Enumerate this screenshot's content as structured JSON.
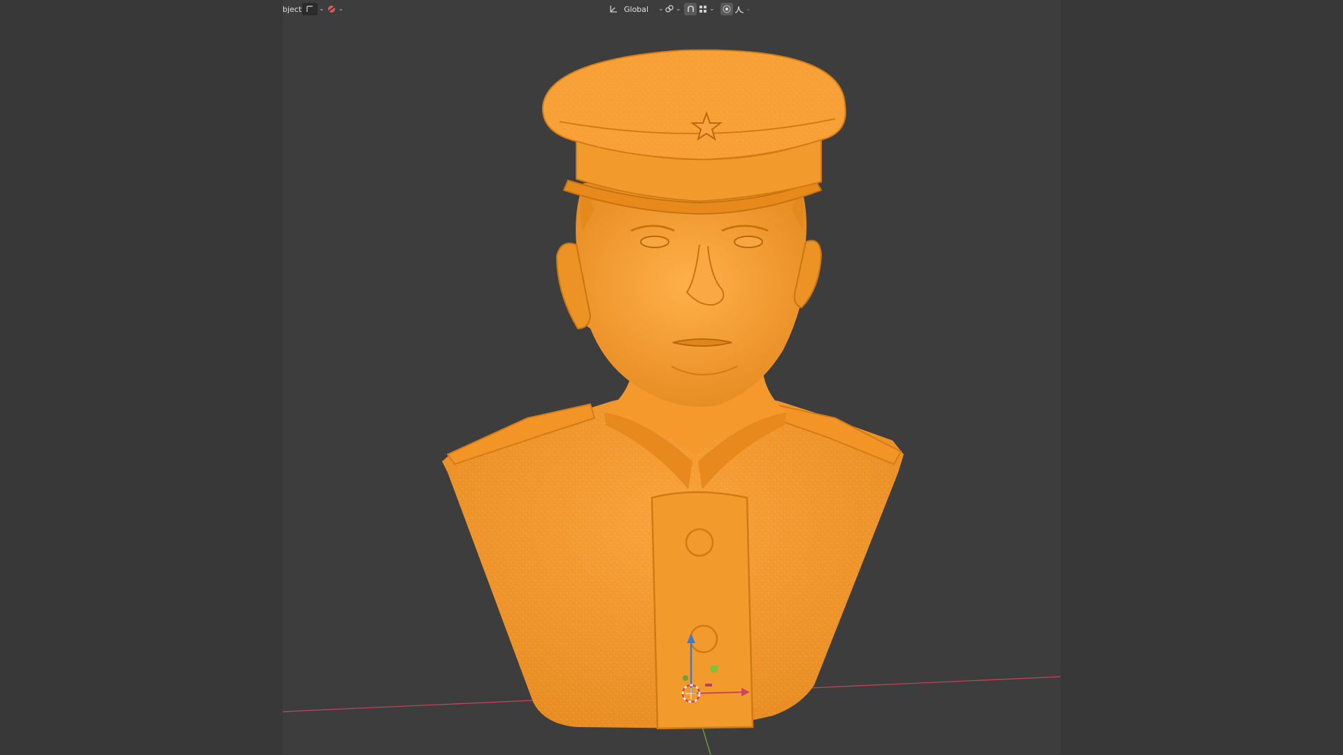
{
  "viewport": {
    "header": {
      "mode_label_partial": "bject",
      "transform_orientation": "Global",
      "icons": [
        "object-mode-icon",
        "transform-orientation-icon",
        "pivot-icon",
        "snap-icon",
        "snap-target-icon",
        "proportional-editing-icon",
        "falloff-icon"
      ]
    },
    "scene": {
      "selected_object": "bust-sculpt",
      "selection_color": "#f59a2a",
      "axes": {
        "x_color": "#c9455b",
        "y_color": "#6aa23a",
        "z_color": "#3b7ad9"
      }
    }
  }
}
